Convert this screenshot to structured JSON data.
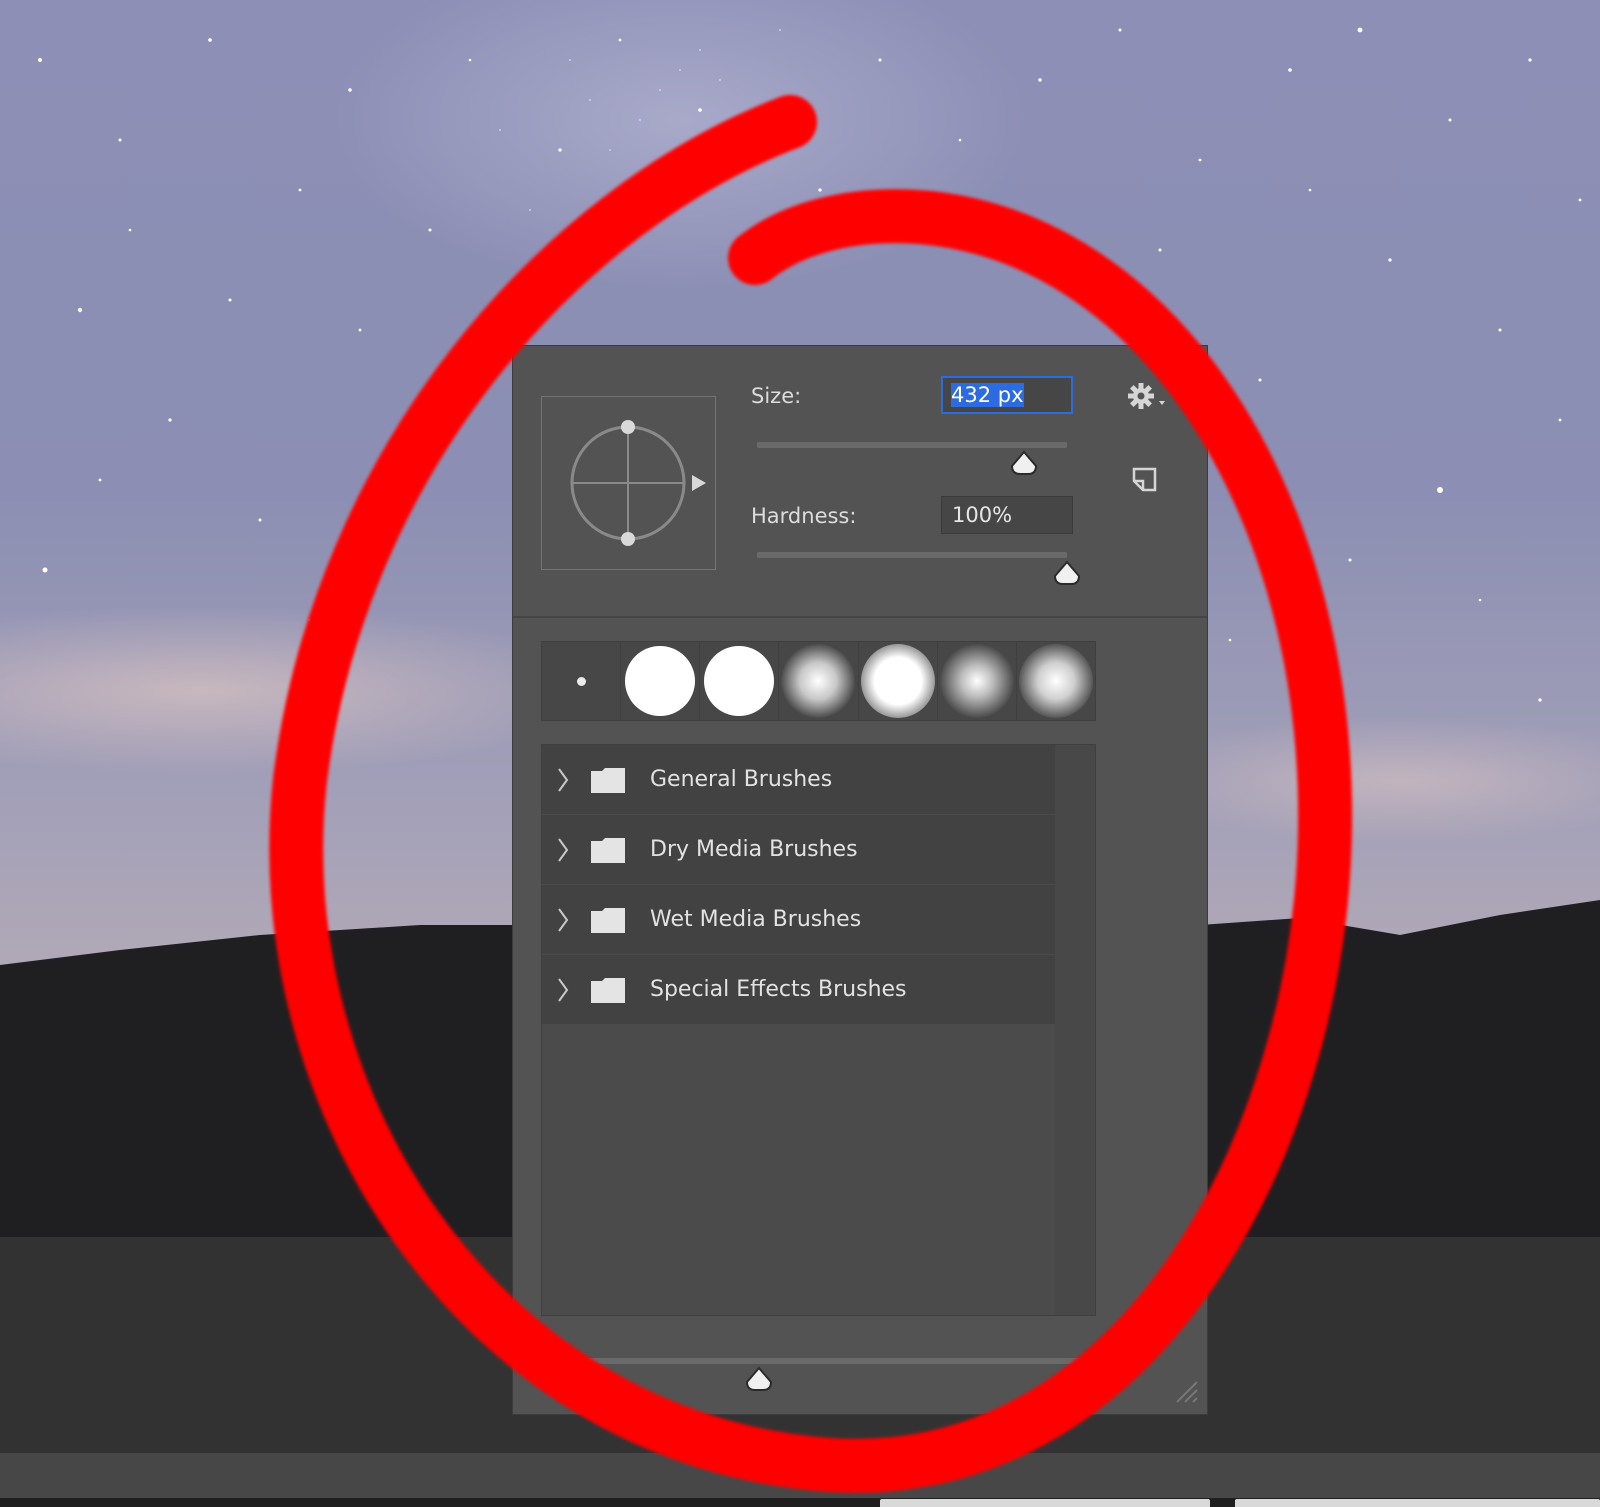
{
  "brush_panel": {
    "size_label": "Size:",
    "size_value": "432 px",
    "size_slider_fraction": 0.86,
    "hardness_label": "Hardness:",
    "hardness_value": "100%",
    "hardness_slider_fraction": 1.0,
    "preview_slider_fraction": 0.38,
    "gear_icon": "gear-icon",
    "new_preset_icon": "new-preset-icon",
    "recent_tips": [
      {
        "name": "tiny-hard-round"
      },
      {
        "name": "hard-round"
      },
      {
        "name": "hard-round-large"
      },
      {
        "name": "soft-round"
      },
      {
        "name": "soft-round-medium"
      },
      {
        "name": "soft-round-large"
      },
      {
        "name": "soft-round-xlarge"
      }
    ],
    "folders": [
      {
        "label": "General Brushes"
      },
      {
        "label": "Dry Media Brushes"
      },
      {
        "label": "Wet Media Brushes"
      },
      {
        "label": "Special Effects Brushes"
      }
    ]
  },
  "colors": {
    "annotation": "#ff0000",
    "selection": "#2d6be0",
    "panel": "#535353"
  }
}
